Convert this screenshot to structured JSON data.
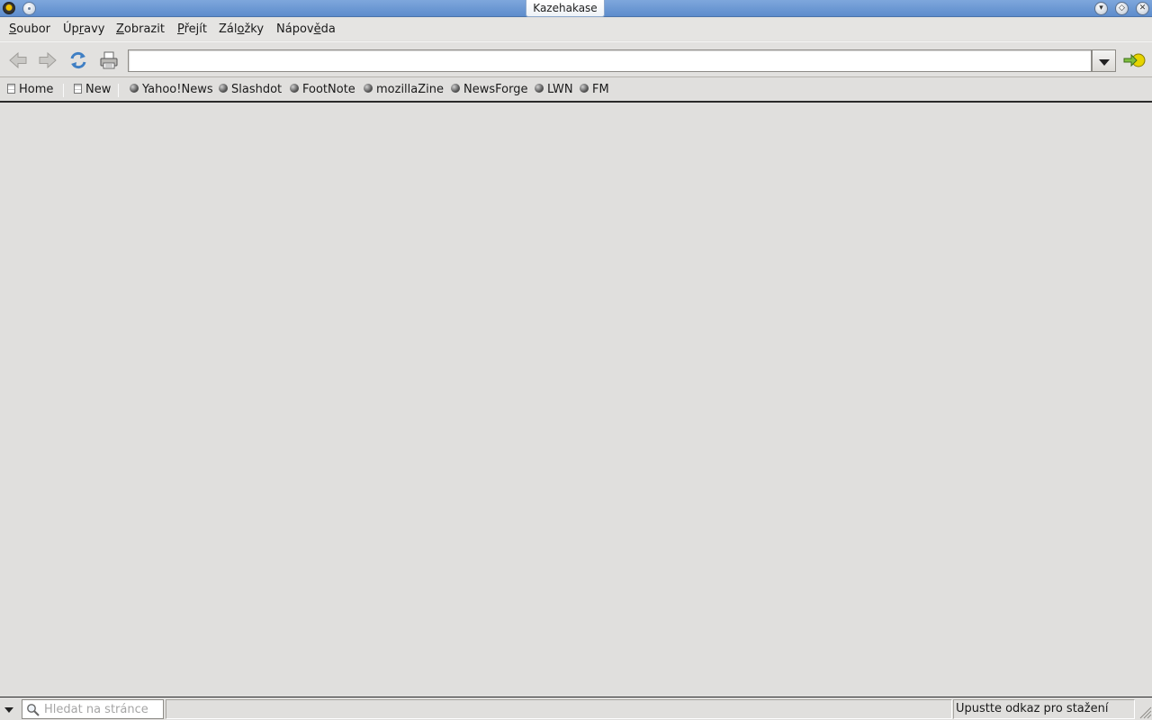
{
  "window": {
    "title": "Kazehakase"
  },
  "menubar": {
    "items": [
      {
        "label": "Soubor",
        "mnemonic": "S",
        "rest": "oubor"
      },
      {
        "label": "Úpravy",
        "pre": "Úp",
        "mnemonic": "r",
        "rest": "avy"
      },
      {
        "label": "Zobrazit",
        "mnemonic": "Z",
        "rest": "obrazit"
      },
      {
        "label": "Přejít",
        "mnemonic": "P",
        "rest": "řejít"
      },
      {
        "label": "Záložky",
        "pre": "Zál",
        "mnemonic": "o",
        "rest": "žky"
      },
      {
        "label": "Nápověda",
        "pre": "Nápov",
        "mnemonic": "ě",
        "rest": "da"
      }
    ]
  },
  "toolbar": {
    "url_value": "",
    "icons": {
      "back": "back-arrow-icon",
      "forward": "forward-arrow-icon",
      "reload": "reload-icon",
      "print": "print-icon",
      "go": "go-icon"
    }
  },
  "bookmarks": {
    "items": [
      {
        "label": "Home",
        "icon": "document-icon"
      },
      {
        "label": "New",
        "icon": "document-icon"
      },
      {
        "label": "Yahoo!News",
        "icon": "globe-icon"
      },
      {
        "label": "Slashdot",
        "icon": "globe-icon"
      },
      {
        "label": "FootNote",
        "icon": "globe-icon"
      },
      {
        "label": "mozillaZine",
        "icon": "globe-icon"
      },
      {
        "label": "NewsForge",
        "icon": "globe-icon"
      },
      {
        "label": "LWN",
        "icon": "globe-icon"
      },
      {
        "label": "FM",
        "icon": "globe-icon"
      }
    ]
  },
  "statusbar": {
    "search_placeholder": "Hledat na stránce",
    "status_text": "Upustte odkaz pro stažení"
  },
  "colors": {
    "titlebar": "#6a98d6",
    "background": "#e0dfdd",
    "go_icon": "#e6d400"
  }
}
